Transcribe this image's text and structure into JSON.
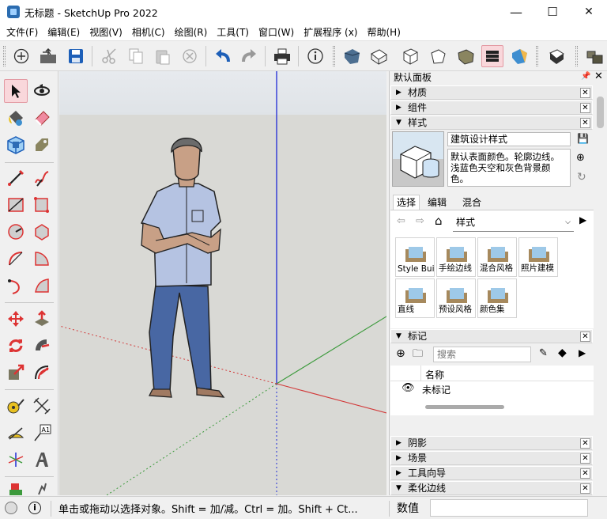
{
  "window": {
    "title": "无标题 - SketchUp Pro 2022",
    "minimize": "—",
    "maximize": "☐",
    "close": "✕"
  },
  "menu": [
    "文件(F)",
    "编辑(E)",
    "视图(V)",
    "相机(C)",
    "绘图(R)",
    "工具(T)",
    "窗口(W)",
    "扩展程序 (x)",
    "帮助(H)"
  ],
  "toolbar": {
    "icons": [
      "new-icon",
      "open-icon",
      "save-icon",
      "cut-icon",
      "copy-icon",
      "paste-icon",
      "erase-icon",
      "undo-icon",
      "redo-icon",
      "print-icon",
      "model-info-icon",
      "iso-view-icon",
      "top-view-icon",
      "front-view-icon",
      "right-view-icon",
      "back-view-icon",
      "left-view-icon",
      "style-icon",
      "xray-icon",
      "section-icon",
      "components-icon"
    ]
  },
  "left_tools": [
    "select-icon",
    "orbit-icon",
    "paint-bucket-icon",
    "eraser-icon",
    "components-icon",
    "tag-icon",
    "line-icon",
    "freehand-icon",
    "rectangle-icon",
    "rotated-rect-icon",
    "circle-icon",
    "polygon-icon",
    "arc-icon",
    "pie-icon",
    "3pt-arc-icon",
    "2pt-arc-icon",
    "move-icon",
    "push-pull-icon",
    "rotate-icon",
    "follow-me-icon",
    "scale-icon",
    "offset-icon",
    "tape-measure-icon",
    "dimension-icon",
    "protractor-icon",
    "text-icon",
    "axes-icon",
    "3d-text-icon"
  ],
  "panel": {
    "title": "默认面板",
    "sections_top": [
      "材质",
      "组件",
      "样式"
    ],
    "style": {
      "name": "建筑设计样式",
      "desc": "默认表面颜色。轮廓边线。浅蓝色天空和灰色背景颜色。"
    },
    "tabs": [
      "选择",
      "编辑",
      "混合"
    ],
    "dropdown": "样式",
    "thumbs": [
      "Style Buil",
      "手绘边线",
      "混合风格",
      "照片建模",
      "直线",
      "预设风格",
      "颜色集"
    ],
    "tags": {
      "title": "标记",
      "search_placeholder": "搜索",
      "col_name": "名称",
      "row": "未标记"
    },
    "sections_bottom": [
      "阴影",
      "场景",
      "工具向导",
      "柔化边线"
    ]
  },
  "status": {
    "message": "单击或拖动以选择对象。Shift = 加/减。Ctrl = 加。Shift + Ct...",
    "value_label": "数值",
    "value": ""
  },
  "colors": {
    "select_highlight": "#f9d7db",
    "axis_blue": "#1f2ad6",
    "axis_red": "#d23a3a",
    "axis_green": "#3c9a3c"
  }
}
